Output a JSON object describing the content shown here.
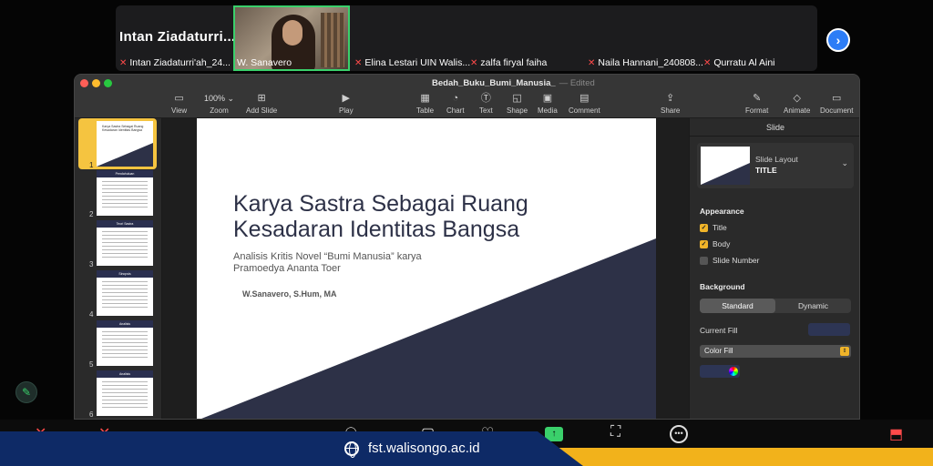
{
  "zoom": {
    "strip_big_name": "Intan  Ziadaturri...",
    "participants": [
      "Intan Ziadaturri'ah_24...",
      "W. Sanavero",
      "Elina Lestari UIN Walis...",
      "zalfa firyal faiha",
      "Naila Hannani_240808...",
      "Qurratu Al Aini"
    ],
    "next_icon": "chevron-right-icon"
  },
  "keynote": {
    "doc_title": "Bedah_Buku_Bumi_Manusia_",
    "doc_status": "— Edited",
    "toolbar": {
      "view": "View",
      "zoom_value": "100% ⌄",
      "zoom": "Zoom",
      "add_slide": "Add Slide",
      "play": "Play",
      "table": "Table",
      "chart": "Chart",
      "text": "Text",
      "shape": "Shape",
      "media": "Media",
      "comment": "Comment",
      "share": "Share",
      "format": "Format",
      "animate": "Animate",
      "document": "Document"
    },
    "thumbnails": [
      {
        "num": "1",
        "title": "Karya Sastra Sebagai Ruang Kesadaran Identitas Bangsa"
      },
      {
        "num": "2",
        "title": "Pendahuluan"
      },
      {
        "num": "3",
        "title": "Teori Sastra"
      },
      {
        "num": "4",
        "title": "Sinopsis"
      },
      {
        "num": "5",
        "title": "Analisis"
      },
      {
        "num": "6",
        "title": "Analisis"
      }
    ],
    "slide": {
      "title_line1": "Karya Sastra Sebagai Ruang",
      "title_line2": "Kesadaran Identitas Bangsa",
      "subtitle_line1": "Analisis Kritis Novel “Bumi Manusia” karya",
      "subtitle_line2": "Pramoedya Ananta Toer",
      "author": "W.Sanavero, S.Hum, MA",
      "accent_color": "#2d3147"
    },
    "inspector": {
      "header": "Slide",
      "layout_label": "Slide Layout",
      "layout_value": "TITLE",
      "appearance": "Appearance",
      "title_cb": "Title",
      "body_cb": "Body",
      "slide_number_cb": "Slide Number",
      "background": "Background",
      "standard": "Standard",
      "dynamic": "Dynamic",
      "current_fill": "Current Fill",
      "fill_type": "Color Fill"
    }
  },
  "footer": {
    "url": "fst.walisongo.ac.id",
    "banner_color": "#0e2a66",
    "gold_color": "#f2b21b"
  }
}
